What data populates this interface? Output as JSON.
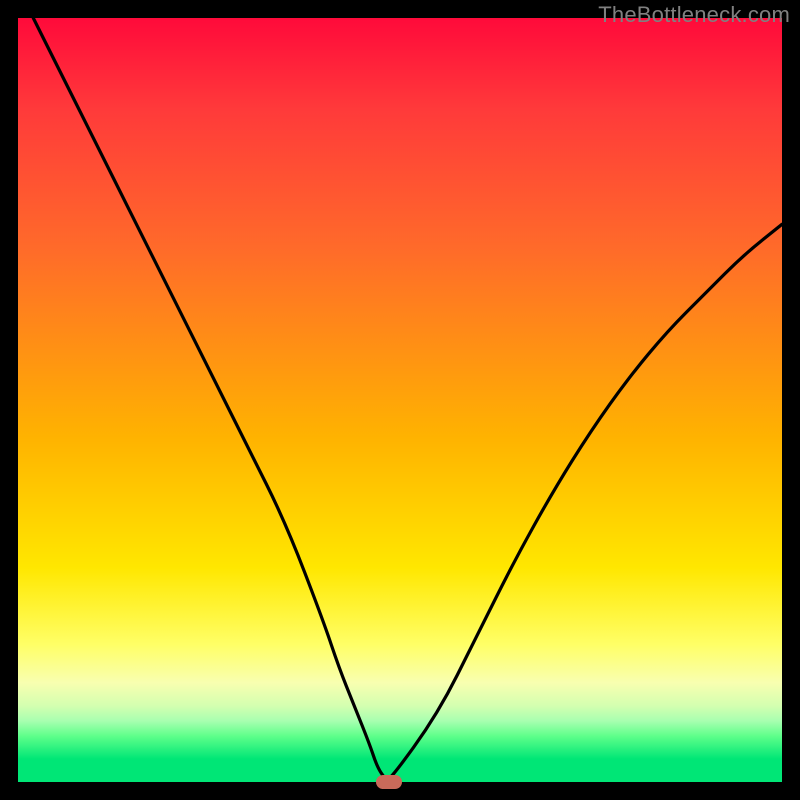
{
  "domain": "Chart",
  "watermark": "TheBottleneck.com",
  "chart_data": {
    "type": "line",
    "title": "",
    "xlabel": "",
    "ylabel": "",
    "xlim": [
      0,
      100
    ],
    "ylim": [
      0,
      100
    ],
    "grid": false,
    "legend": false,
    "x": [
      2,
      5,
      10,
      15,
      20,
      25,
      30,
      35,
      40,
      42,
      44,
      46,
      47,
      48,
      48.5,
      55,
      60,
      65,
      70,
      75,
      80,
      85,
      90,
      95,
      100
    ],
    "y": [
      100,
      94,
      84,
      74,
      64,
      54,
      44,
      34,
      21,
      15,
      10,
      5,
      2,
      0.5,
      0,
      9,
      19,
      29,
      38,
      46,
      53,
      59,
      64,
      69,
      73
    ],
    "marker": {
      "x": 48.5,
      "y": 0
    },
    "gradient_stops": [
      {
        "pos": 0,
        "color": "#ff0a3a"
      },
      {
        "pos": 12,
        "color": "#ff3a3a"
      },
      {
        "pos": 30,
        "color": "#ff6a2a"
      },
      {
        "pos": 55,
        "color": "#ffb300"
      },
      {
        "pos": 72,
        "color": "#ffe700"
      },
      {
        "pos": 82,
        "color": "#ffff66"
      },
      {
        "pos": 87,
        "color": "#f8ffb0"
      },
      {
        "pos": 90,
        "color": "#d4ffb0"
      },
      {
        "pos": 92,
        "color": "#a8ffb0"
      },
      {
        "pos": 94,
        "color": "#5eff8a"
      },
      {
        "pos": 97,
        "color": "#00e676"
      },
      {
        "pos": 100,
        "color": "#00e676"
      }
    ],
    "colors": {
      "curve": "#000000",
      "marker": "#c96a5a",
      "frame": "#000000"
    }
  }
}
